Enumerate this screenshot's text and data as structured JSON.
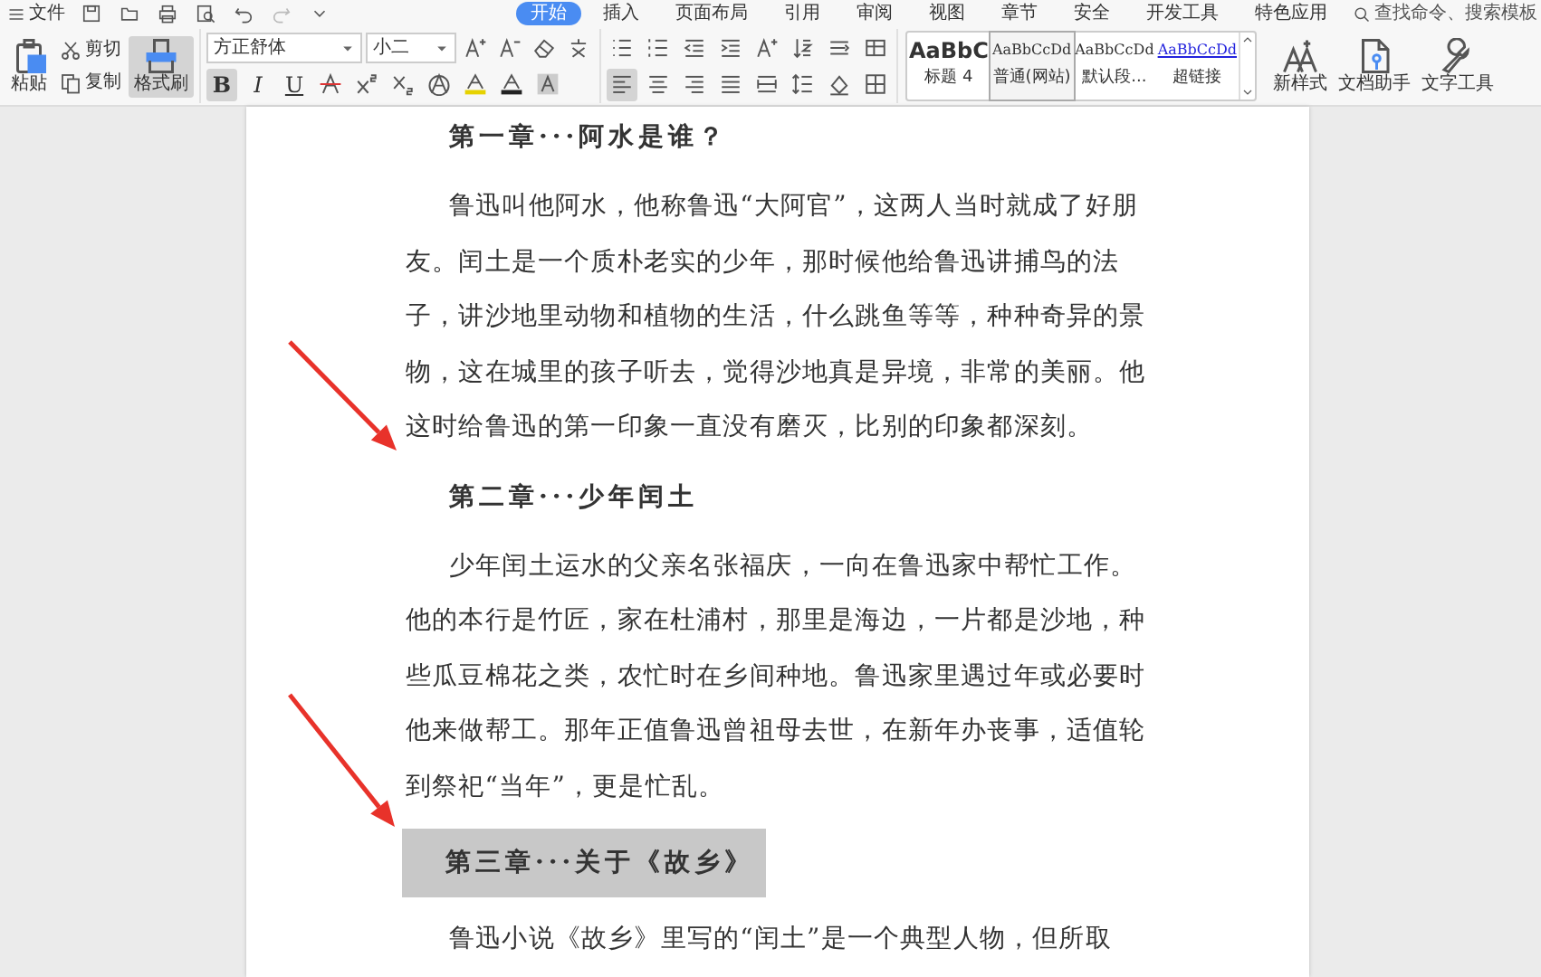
{
  "menu": {
    "file": "文件",
    "tabs": [
      {
        "label": "开始",
        "selected": true
      },
      {
        "label": "插入",
        "selected": false
      },
      {
        "label": "页面布局",
        "selected": false
      },
      {
        "label": "引用",
        "selected": false
      },
      {
        "label": "审阅",
        "selected": false
      },
      {
        "label": "视图",
        "selected": false
      },
      {
        "label": "章节",
        "selected": false
      },
      {
        "label": "安全",
        "selected": false
      },
      {
        "label": "开发工具",
        "selected": false
      },
      {
        "label": "特色应用",
        "selected": false
      }
    ],
    "search": {
      "placeholder": "查找命令、搜索模板"
    }
  },
  "clipboard": {
    "paste": "粘贴",
    "cut": "剪切",
    "copy": "复制",
    "format_painter": {
      "label": "格式刷",
      "active": true
    }
  },
  "font": {
    "family": "方正舒体",
    "size": "小二",
    "tools": [
      {
        "kind": "bold",
        "label": "B",
        "active": true
      },
      {
        "kind": "italic",
        "label": "I",
        "active": false
      },
      {
        "kind": "underline",
        "label": "U",
        "active": false
      },
      {
        "kind": "strike",
        "active": false
      },
      {
        "kind": "superscript",
        "active": false
      },
      {
        "kind": "subscript",
        "active": false
      },
      {
        "kind": "outline",
        "active": false
      },
      {
        "kind": "highlight",
        "active": false
      },
      {
        "kind": "color",
        "active": false
      },
      {
        "kind": "shade",
        "active": false
      }
    ]
  },
  "paragraph": {
    "tools": [
      {
        "kind": "align-left",
        "active": true
      },
      {
        "kind": "align-center",
        "active": false
      },
      {
        "kind": "align-right",
        "active": false
      },
      {
        "kind": "justify",
        "active": false
      },
      {
        "kind": "distribute",
        "active": false
      },
      {
        "kind": "line-spacing",
        "active": false
      },
      {
        "kind": "shading",
        "active": false
      },
      {
        "kind": "borders",
        "active": false
      }
    ]
  },
  "styles": [
    {
      "preview": "AaBbC",
      "label": "标题 4",
      "kind": "heading",
      "selected": false
    },
    {
      "preview": "AaBbCcDd",
      "label": "普通(网站)",
      "kind": "normal",
      "selected": true
    },
    {
      "preview": "AaBbCcDd",
      "label": "默认段...",
      "kind": "normal",
      "selected": false
    },
    {
      "preview": "AaBbCcDd",
      "label": "超链接",
      "kind": "link",
      "selected": false
    }
  ],
  "actions": {
    "new_style": "新样式",
    "doc_assistant": "文档助手",
    "text_tools": "文字工具"
  },
  "document": [
    {
      "kind": "heading",
      "text": "第一章···阿水是谁？",
      "highlighted": false
    },
    {
      "kind": "paragraph",
      "text": "鲁迅叫他阿水，他称鲁迅“大阿官”，这两人当时就成了好朋友。闰土是一个质朴老实的少年，那时候他给鲁迅讲捕鸟的法子，讲沙地里动物和植物的生活，什么跳鱼等等，种种奇异的景物，这在城里的孩子听去，觉得沙地真是异境，非常的美丽。他这时给鲁迅的第一印象一直没有磨灭，比别的印象都深刻。"
    },
    {
      "kind": "heading",
      "text": "第二章···少年闰土",
      "highlighted": false
    },
    {
      "kind": "paragraph",
      "text": "少年闰土运水的父亲名张福庆，一向在鲁迅家中帮忙工作。他的本行是竹匠，家在杜浦村，那里是海边，一片都是沙地，种些瓜豆棉花之类，农忙时在乡间种地。鲁迅家里遇过年或必要时他来做帮工。那年正值鲁迅曾祖母去世，在新年办丧事，适值轮到祭祀“当年”，更是忙乱。"
    },
    {
      "kind": "heading",
      "text": "第三章···关于《故乡》",
      "highlighted": true
    },
    {
      "kind": "paragraph",
      "text": "鲁迅小说《故乡》里写的“闰土”是一个典型人物，但所取"
    }
  ]
}
